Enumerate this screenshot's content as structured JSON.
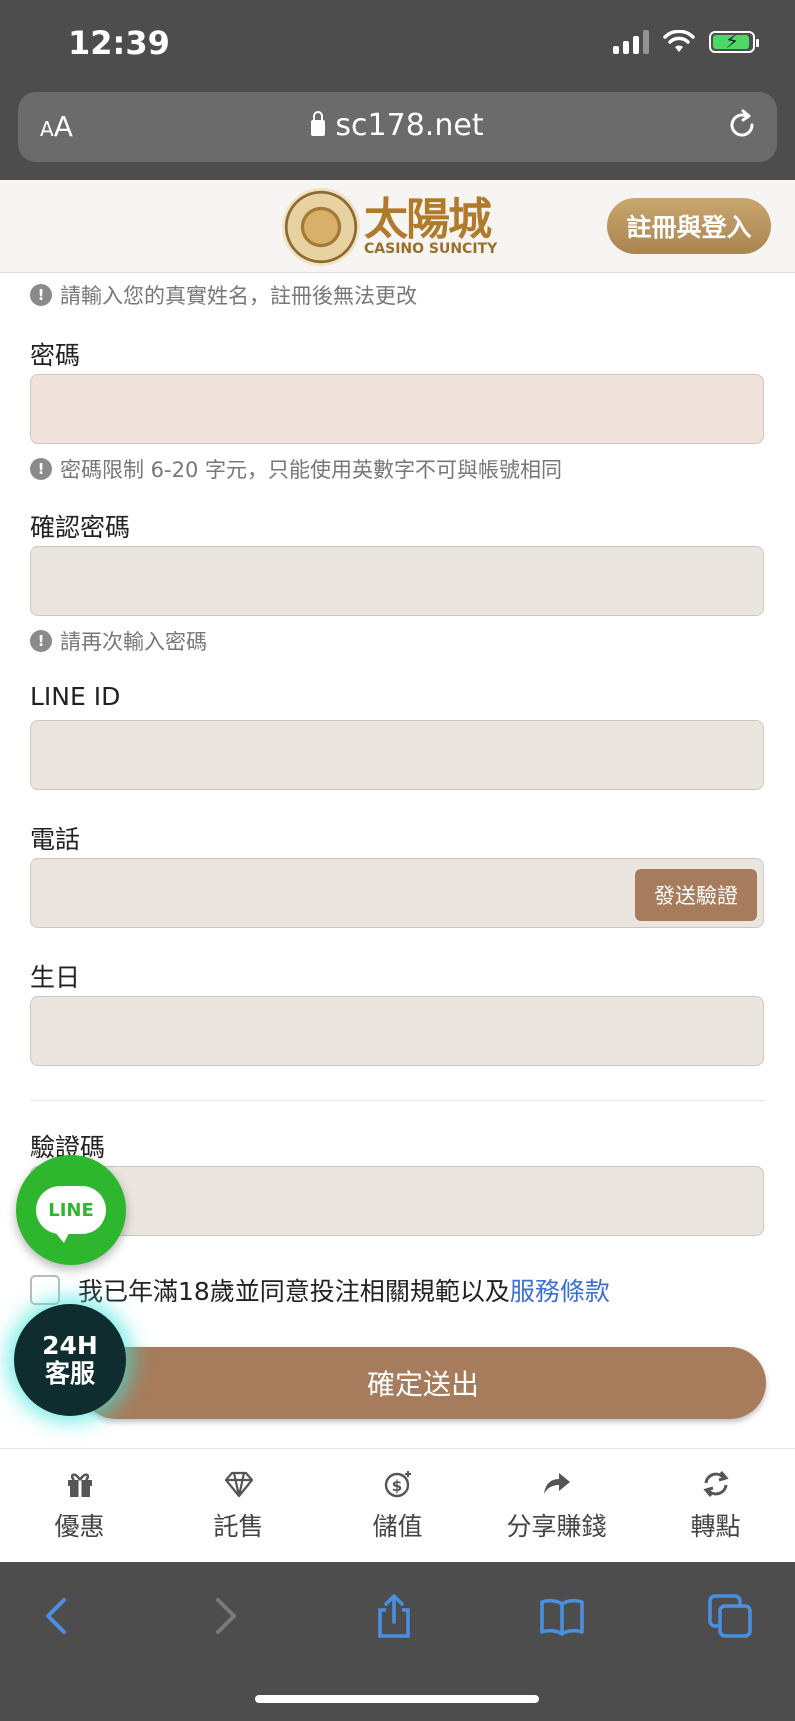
{
  "status": {
    "time": "12:39"
  },
  "browser": {
    "text_size": "AA",
    "url": "sc178.net"
  },
  "header": {
    "logo_cn": "太陽城",
    "logo_en": "CASINO SUNCITY",
    "register_login": "註冊與登入"
  },
  "form": {
    "name_hint": "請輸入您的真實姓名，註冊後無法更改",
    "password_label": "密碼",
    "password_hint": "密碼限制 6-20 字元，只能使用英數字不可與帳號相同",
    "confirm_label": "確認密碼",
    "confirm_hint": "請再次輸入密碼",
    "line_label": "LINE ID",
    "phone_label": "電話",
    "send_verify": "發送驗證",
    "birthday_label": "生日",
    "captcha_label": "驗證碼",
    "agree_text": "我已年滿18歲並同意投注相關規範以及",
    "terms_link": "服務條款",
    "submit": "確定送出"
  },
  "fabs": {
    "line": "LINE",
    "cs_line1": "24H",
    "cs_line2": "客服"
  },
  "nav": [
    {
      "label": "優惠",
      "icon": "gift-icon"
    },
    {
      "label": "託售",
      "icon": "diamond-icon"
    },
    {
      "label": "儲值",
      "icon": "dollar-coin-icon"
    },
    {
      "label": "分享賺錢",
      "icon": "share-arrow-icon"
    },
    {
      "label": "轉點",
      "icon": "exchange-icon"
    }
  ],
  "colors": {
    "accent": "#a67c5c",
    "gold": "#b07a2a",
    "link": "#3b6fd6",
    "line_green": "#2fb62f"
  }
}
